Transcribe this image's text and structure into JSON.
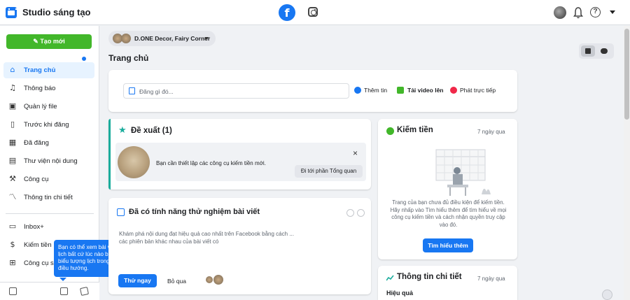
{
  "header": {
    "app_title": "Studio sáng tạo",
    "icons": [
      "calendar-icon",
      "facebook-icon",
      "instagram-icon",
      "notification-bell-icon",
      "help-icon",
      "account-caret-icon"
    ],
    "fb_glyph": "f",
    "help_glyph": "?"
  },
  "sidebar": {
    "create_label": "Tạo mới",
    "items": [
      {
        "label": "Trang chủ",
        "icon": "home-icon",
        "glyph": "⌂"
      },
      {
        "label": "Thông báo",
        "icon": "bell-icon",
        "glyph": "♫"
      },
      {
        "label": "Quản lý file",
        "icon": "file-manager-icon",
        "glyph": "▣"
      },
      {
        "label": "Trước khi đăng",
        "icon": "draft-icon",
        "glyph": "▯"
      },
      {
        "label": "Đã đăng",
        "icon": "published-icon",
        "glyph": "▦"
      },
      {
        "label": "Thư viện nội dung",
        "icon": "content-library-icon",
        "glyph": "▤"
      },
      {
        "label": "Công cụ",
        "icon": "tools-icon",
        "glyph": "⚒"
      },
      {
        "label": "Thông tin chi tiết",
        "icon": "insights-icon",
        "glyph": "〽"
      },
      {
        "label": "Inbox+",
        "icon": "inbox-icon",
        "glyph": "▭"
      },
      {
        "label": "Kiếm tiền",
        "icon": "monetization-icon",
        "glyph": "$"
      },
      {
        "label": "Công cụ s",
        "icon": "creator-tools-icon",
        "glyph": "⊞"
      }
    ]
  },
  "tooltip": {
    "text": "Bạn có thể xem bài viết của mình ở dạng lịch bất cứ lúc nào bằng cách nhấp vào biểu tượng lịch trong phần chân trang điều hướng.",
    "close": "×"
  },
  "main": {
    "page_selector": "D.ONE Decor, Fairy Corner",
    "page_title": "Trang chủ",
    "composer": {
      "placeholder": "Đăng gì đó...",
      "actions": [
        "Thêm tin",
        "Tải video lên",
        "Phát trực tiếp"
      ]
    },
    "suggest": {
      "title": "Đề xuất (1)",
      "text": "Bạn cần thiết lập các công cụ kiếm tiền mới.",
      "close": "×",
      "button": "Đi tới phần Tổng quan"
    },
    "experiment": {
      "title": "Đã có tính năng thử nghiệm bài viết",
      "desc_visible": "Khám phá nội dung đạt hiệu quả cao nhất trên Facebook bằng cách ... các phiên bản khác nhau của bài viết có",
      "try_label": "Thử ngay",
      "skip_label": "Bỏ qua"
    },
    "monetize": {
      "title": "Kiếm tiền",
      "time": "7 ngày qua",
      "desc": "Trang của bạn chưa đủ điều kiện để kiếm tiền. Hãy nhấp vào Tìm hiểu thêm để tìm hiểu về mọi công cụ kiếm tiền và cách nhận quyền truy cập vào đó.",
      "button": "Tìm hiểu thêm"
    },
    "insights": {
      "title": "Thông tin chi tiết",
      "time": "7 ngày qua",
      "subheading": "Hiệu quả"
    }
  },
  "colors": {
    "brand_blue": "#1877f2",
    "create_green": "#42b72a",
    "suggest_teal": "#1aac9c"
  }
}
